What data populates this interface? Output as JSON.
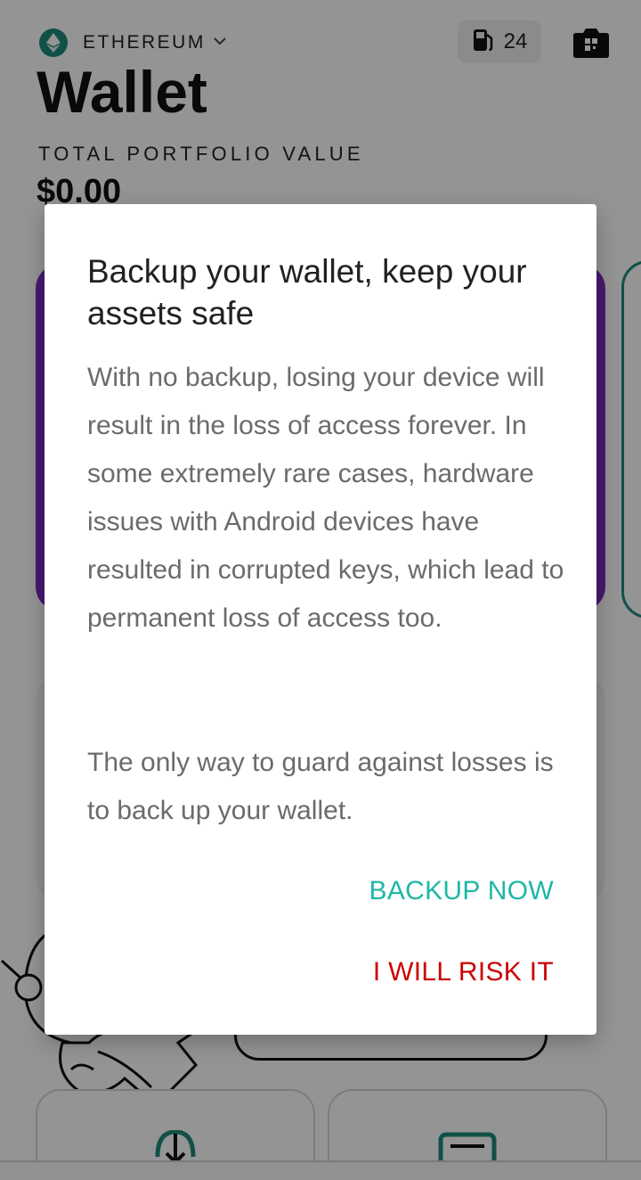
{
  "header": {
    "network_label": "ETHEREUM",
    "gas_count": "24",
    "title": "Wallet",
    "portfolio_label": "TOTAL PORTFOLIO VALUE",
    "portfolio_value": "$0.00"
  },
  "icons": {
    "network": "ethereum-icon",
    "network_dropdown": "chevron-down-icon",
    "gas": "gas-pump-icon",
    "scan": "qr-camera-icon",
    "receive": "download-icon",
    "card": "card-icon"
  },
  "dialog": {
    "title": "Backup your wallet, keep your assets safe",
    "body_paragraph_1": "With no backup, losing your device will result in the loss of access forever. In some extremely rare cases, hardware issues with Android devices have resulted in corrupted keys, which lead to permanent loss of access too.",
    "body_paragraph_2": "The only way to guard against losses is to back up your wallet.",
    "primary_button": "BACKUP NOW",
    "secondary_button": "I WILL RISK IT"
  },
  "colors": {
    "primary_accent": "#1fb7a6",
    "danger": "#cc0000",
    "ethereum": "#1e8a7d",
    "card_purple": "#7b2bbf",
    "scrim": "rgba(0,0,0,0.42)"
  }
}
